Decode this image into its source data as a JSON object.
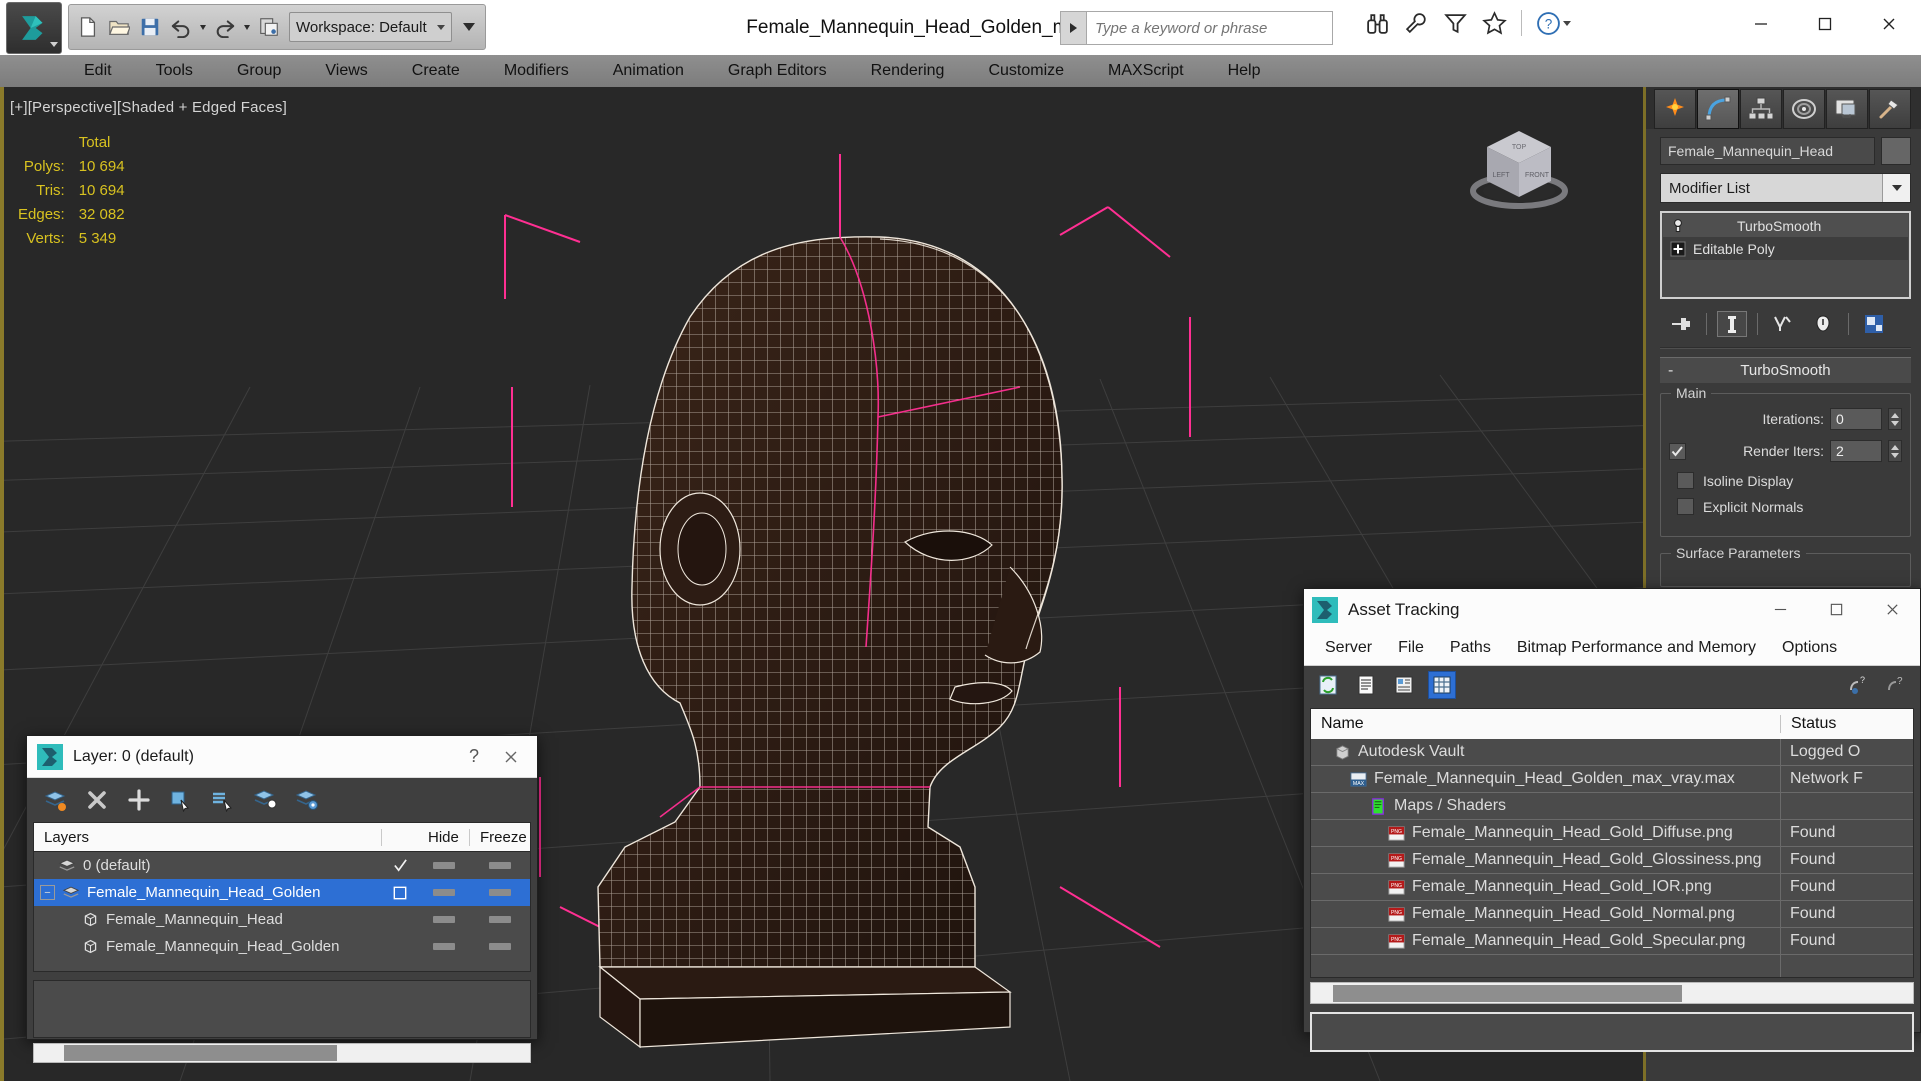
{
  "app": {
    "document_title": "Female_Mannequin_Head_Golden_max_vray.max",
    "workspace_label": "Workspace: Default",
    "search_placeholder": "Type a keyword or phrase"
  },
  "menubar": {
    "items": [
      "Edit",
      "Tools",
      "Group",
      "Views",
      "Create",
      "Modifiers",
      "Animation",
      "Graph Editors",
      "Rendering",
      "Customize",
      "MAXScript",
      "Help"
    ]
  },
  "viewport": {
    "label": "[+][Perspective][Shaded + Edged Faces]",
    "stats": {
      "header": "Total",
      "rows": [
        {
          "label": "Polys:",
          "value": "10 694"
        },
        {
          "label": "Tris:",
          "value": "10 694"
        },
        {
          "label": "Edges:",
          "value": "32 082"
        },
        {
          "label": "Verts:",
          "value": "5 349"
        }
      ]
    },
    "viewcube_faces": {
      "top": "TOP",
      "left": "LEFT",
      "front": "FRONT"
    },
    "colors": {
      "background": "#282828",
      "grid": "#3c3c3c",
      "mesh_fill": "#2e1d16",
      "wire": "#f2ece4",
      "selection_bracket": "#ff2f92"
    }
  },
  "command_panel": {
    "tabs": [
      "create-tab",
      "modify-tab",
      "hierarchy-tab",
      "motion-tab",
      "display-tab",
      "utilities-tab"
    ],
    "active_tab_index": 1,
    "object_name": "Female_Mannequin_Head",
    "modifier_list_label": "Modifier List",
    "stack": [
      {
        "label": "TurboSmooth",
        "selected": true
      },
      {
        "label": "Editable Poly",
        "selected": false
      }
    ],
    "stack_buttons": [
      "pin-stack-icon",
      "show-end-result-icon",
      "make-unique-icon",
      "remove-modifier-icon",
      "configure-sets-icon"
    ],
    "rollout": {
      "title": "TurboSmooth",
      "collapse_sign": "-",
      "group_main": "Main",
      "iterations_label": "Iterations:",
      "iterations_value": "0",
      "render_iters_label": "Render Iters:",
      "render_iters_value": "2",
      "render_iters_checked": true,
      "isoline_display_label": "Isoline Display",
      "isoline_display_checked": false,
      "explicit_normals_label": "Explicit Normals",
      "explicit_normals_checked": false,
      "group_surface": "Surface Parameters"
    }
  },
  "layer_dialog": {
    "title": "Layer: 0 (default)",
    "help_glyph": "?",
    "toolbar": [
      "create-new-layer-icon",
      "delete-layer-icon",
      "add-layer-icon",
      "select-objects-icon",
      "select-highlighted-icon",
      "highlight-selected-icon",
      "layer-properties-icon"
    ],
    "columns": [
      "Layers",
      "",
      "Hide",
      "Freeze"
    ],
    "rows": [
      {
        "name": "0 (default)",
        "indent": 1,
        "icon": "layer-icon",
        "current": true,
        "selected": false,
        "expander": false
      },
      {
        "name": "Female_Mannequin_Head_Golden",
        "indent": 0,
        "icon": "layer-icon",
        "current": false,
        "selected": true,
        "expander": true,
        "expander_glyph": "−"
      },
      {
        "name": "Female_Mannequin_Head",
        "indent": 2,
        "icon": "object-icon",
        "current": false,
        "selected": false,
        "expander": false
      },
      {
        "name": "Female_Mannequin_Head_Golden",
        "indent": 2,
        "icon": "object-icon",
        "current": false,
        "selected": false,
        "expander": false
      }
    ]
  },
  "asset_tracking": {
    "title": "Asset Tracking",
    "menu": [
      "Server",
      "File",
      "Paths",
      "Bitmap Performance and Memory",
      "Options"
    ],
    "toolbar": [
      "refresh-icon",
      "list-view-icon",
      "detail-view-icon",
      "grid-view-icon"
    ],
    "toolbar_selected_index": 3,
    "toolbar_right": [
      "help-add-icon",
      "help-query-icon"
    ],
    "columns": [
      "Name",
      "Status"
    ],
    "rows": [
      {
        "name": "Autodesk Vault",
        "status": "Logged O",
        "icon": "vault-icon",
        "indent": 1
      },
      {
        "name": "Female_Mannequin_Head_Golden_max_vray.max",
        "status": "Network F",
        "icon": "max-file-icon",
        "indent": 2
      },
      {
        "name": "Maps / Shaders",
        "status": "",
        "icon": "maps-shaders-icon",
        "indent": 3
      },
      {
        "name": "Female_Mannequin_Head_Gold_Diffuse.png",
        "status": "Found",
        "icon": "png-icon",
        "indent": 4
      },
      {
        "name": "Female_Mannequin_Head_Gold_Glossiness.png",
        "status": "Found",
        "icon": "png-icon",
        "indent": 4
      },
      {
        "name": "Female_Mannequin_Head_Gold_IOR.png",
        "status": "Found",
        "icon": "png-icon",
        "indent": 4
      },
      {
        "name": "Female_Mannequin_Head_Gold_Normal.png",
        "status": "Found",
        "icon": "png-icon",
        "indent": 4
      },
      {
        "name": "Female_Mannequin_Head_Gold_Specular.png",
        "status": "Found",
        "icon": "png-icon",
        "indent": 4
      },
      {
        "name": "",
        "status": "",
        "icon": "",
        "indent": 0
      }
    ]
  }
}
